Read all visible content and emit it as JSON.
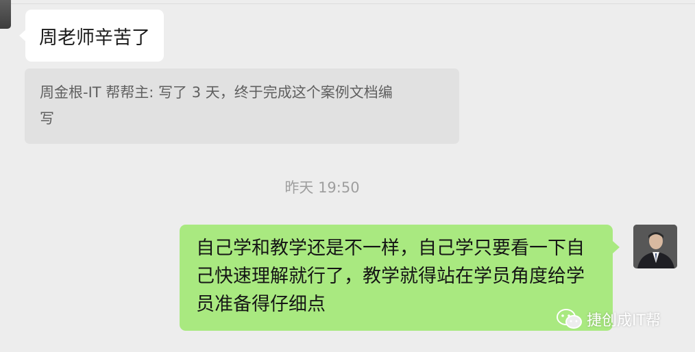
{
  "messages": {
    "incoming": {
      "text": "周老师辛苦了"
    },
    "quote": {
      "line1": "周金根-IT 帮帮主: 写了 3 天，终于完成这个案例文档编",
      "line2": "写"
    },
    "timestamp": "昨天 19:50",
    "outgoing": {
      "line1": "自己学和教学还是不一样，自己学只要看一下自",
      "line2": "己快速理解就行了，教学就得站在学员角度给学",
      "line3": "员准备得仔细点"
    }
  },
  "watermark": {
    "text": "捷创成IT帮"
  },
  "icons": {
    "incoming_avatar": "avatar-icon",
    "outgoing_avatar": "avatar-icon",
    "watermark_logo": "wechat-logo-icon"
  }
}
